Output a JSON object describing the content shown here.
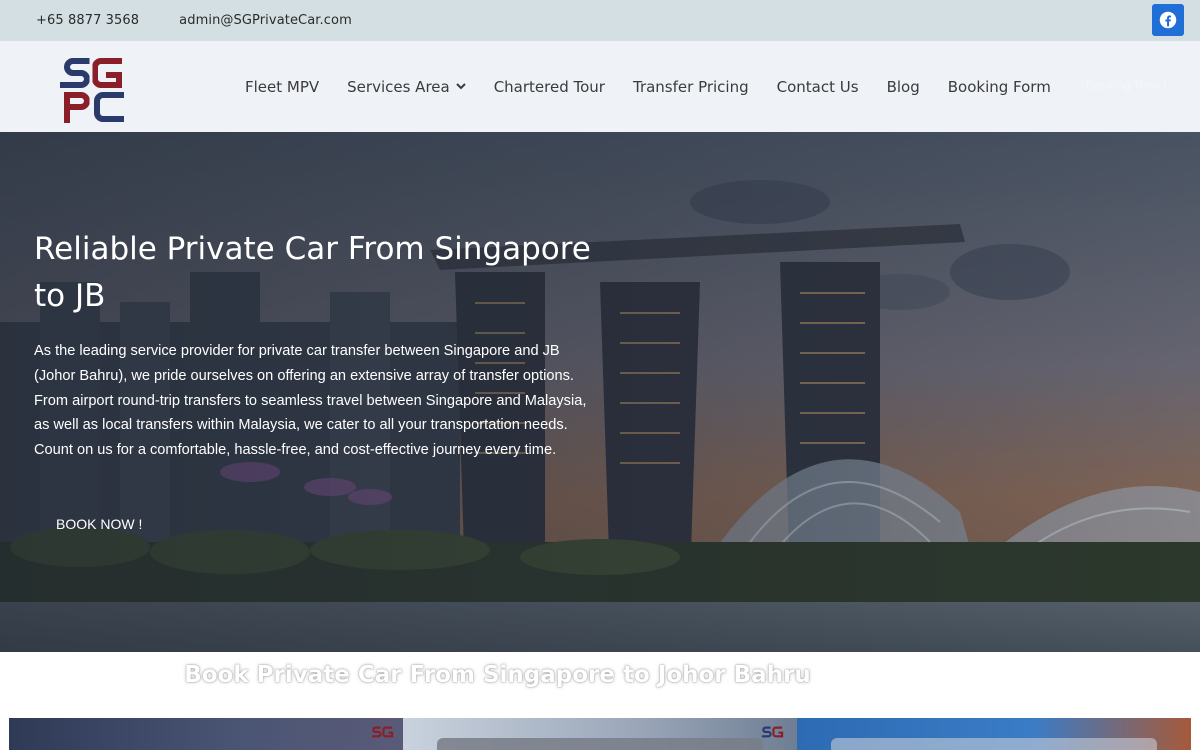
{
  "topbar": {
    "phone": "+65 8877 3568",
    "email": "admin@SGPrivateCar.com",
    "facebook_icon": "facebook-icon"
  },
  "header": {
    "logo_text": "SGPC",
    "nav": [
      {
        "label": "Fleet MPV"
      },
      {
        "label": "Services Area",
        "has_dropdown": true
      },
      {
        "label": "Chartered Tour"
      },
      {
        "label": "Transfer Pricing"
      },
      {
        "label": "Contact Us"
      },
      {
        "label": "Blog"
      },
      {
        "label": "Booking Form"
      }
    ],
    "cta": "Booking Now !"
  },
  "hero": {
    "title": "Reliable Private Car From Singapore to JB",
    "text": "As the leading service provider for private car transfer between Singapore and JB (Johor Bahru), we pride ourselves on offering an extensive array of transfer options. From airport round-trip transfers to seamless travel between Singapore and Malaysia, as well as local transfers within Malaysia, we cater to all your transportation needs. Count on us for a comfortable, hassle-free, and cost-effective journey every time.",
    "button": "BOOK NOW !"
  },
  "section": {
    "title": "Book Private Car From Singapore to Johor Bahru"
  },
  "colors": {
    "topbar_bg": "#d3dfe2",
    "header_bg": "#eff2f7",
    "facebook_blue": "#1f6fd6",
    "logo_navy": "#2a3a6a",
    "logo_red": "#8a1f2a"
  }
}
